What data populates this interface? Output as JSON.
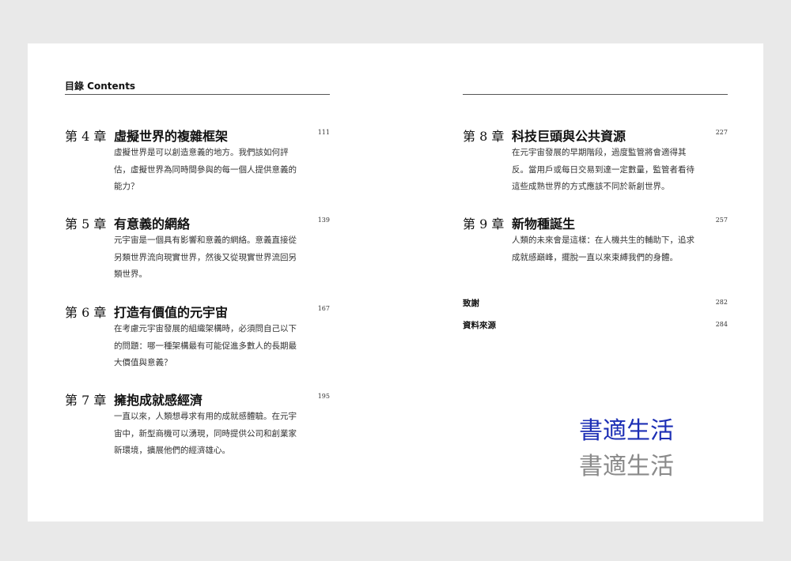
{
  "header": {
    "title": "目錄  Contents"
  },
  "left_chapters": [
    {
      "num": "第 4 章",
      "title": "虛擬世界的複雜框架",
      "page": "111",
      "lines": [
        "虛擬世界是可以創造意義的地方。我們該如何評",
        "估，虛擬世界為同時間參與的每一個人提供意義的",
        "能力？"
      ]
    },
    {
      "num": "第 5 章",
      "title": "有意義的網絡",
      "page": "139",
      "lines": [
        "元宇宙是一個具有影響和意義的網絡。意義直接從",
        "另類世界流向現實世界，然後又從現實世界流回另",
        "類世界。"
      ]
    },
    {
      "num": "第 6 章",
      "title": "打造有價值的元宇宙",
      "page": "167",
      "lines": [
        "在考慮元宇宙發展的組織架構時，必須問自己以下",
        "的問題：哪一種架構最有可能促進多數人的長期最",
        "大價值與意義？"
      ]
    },
    {
      "num": "第 7 章",
      "title": "擁抱成就感經濟",
      "page": "195",
      "lines": [
        "一直以來，人類想尋求有用的成就感體驗。在元宇",
        "宙中，新型商機可以湧現，同時提供公司和創業家",
        "新環境，擴展他們的經濟雄心。"
      ]
    }
  ],
  "right_chapters": [
    {
      "num": "第 8 章",
      "title": "科技巨頭與公共資源",
      "page": "227",
      "lines": [
        "在元宇宙發展的早期階段，過度監管將會適得其",
        "反。當用戶或每日交易到達一定數量，監管者看待",
        "這些成熟世界的方式應該不同於新創世界。"
      ]
    },
    {
      "num": "第 9 章",
      "title": "新物種誕生",
      "page": "257",
      "lines": [
        "人類的未來會是這樣：在人機共生的輔助下，追求",
        "成就感巔峰，擺脫一直以來束縛我們的身體。"
      ]
    }
  ],
  "appendix": [
    {
      "label": "致謝",
      "page": "282"
    },
    {
      "label": "資料來源",
      "page": "284"
    }
  ],
  "watermark": {
    "line1": "書適生活",
    "line2": "書適生活",
    "color1": "#1d2fb5",
    "color2": "#8a8a8a"
  }
}
